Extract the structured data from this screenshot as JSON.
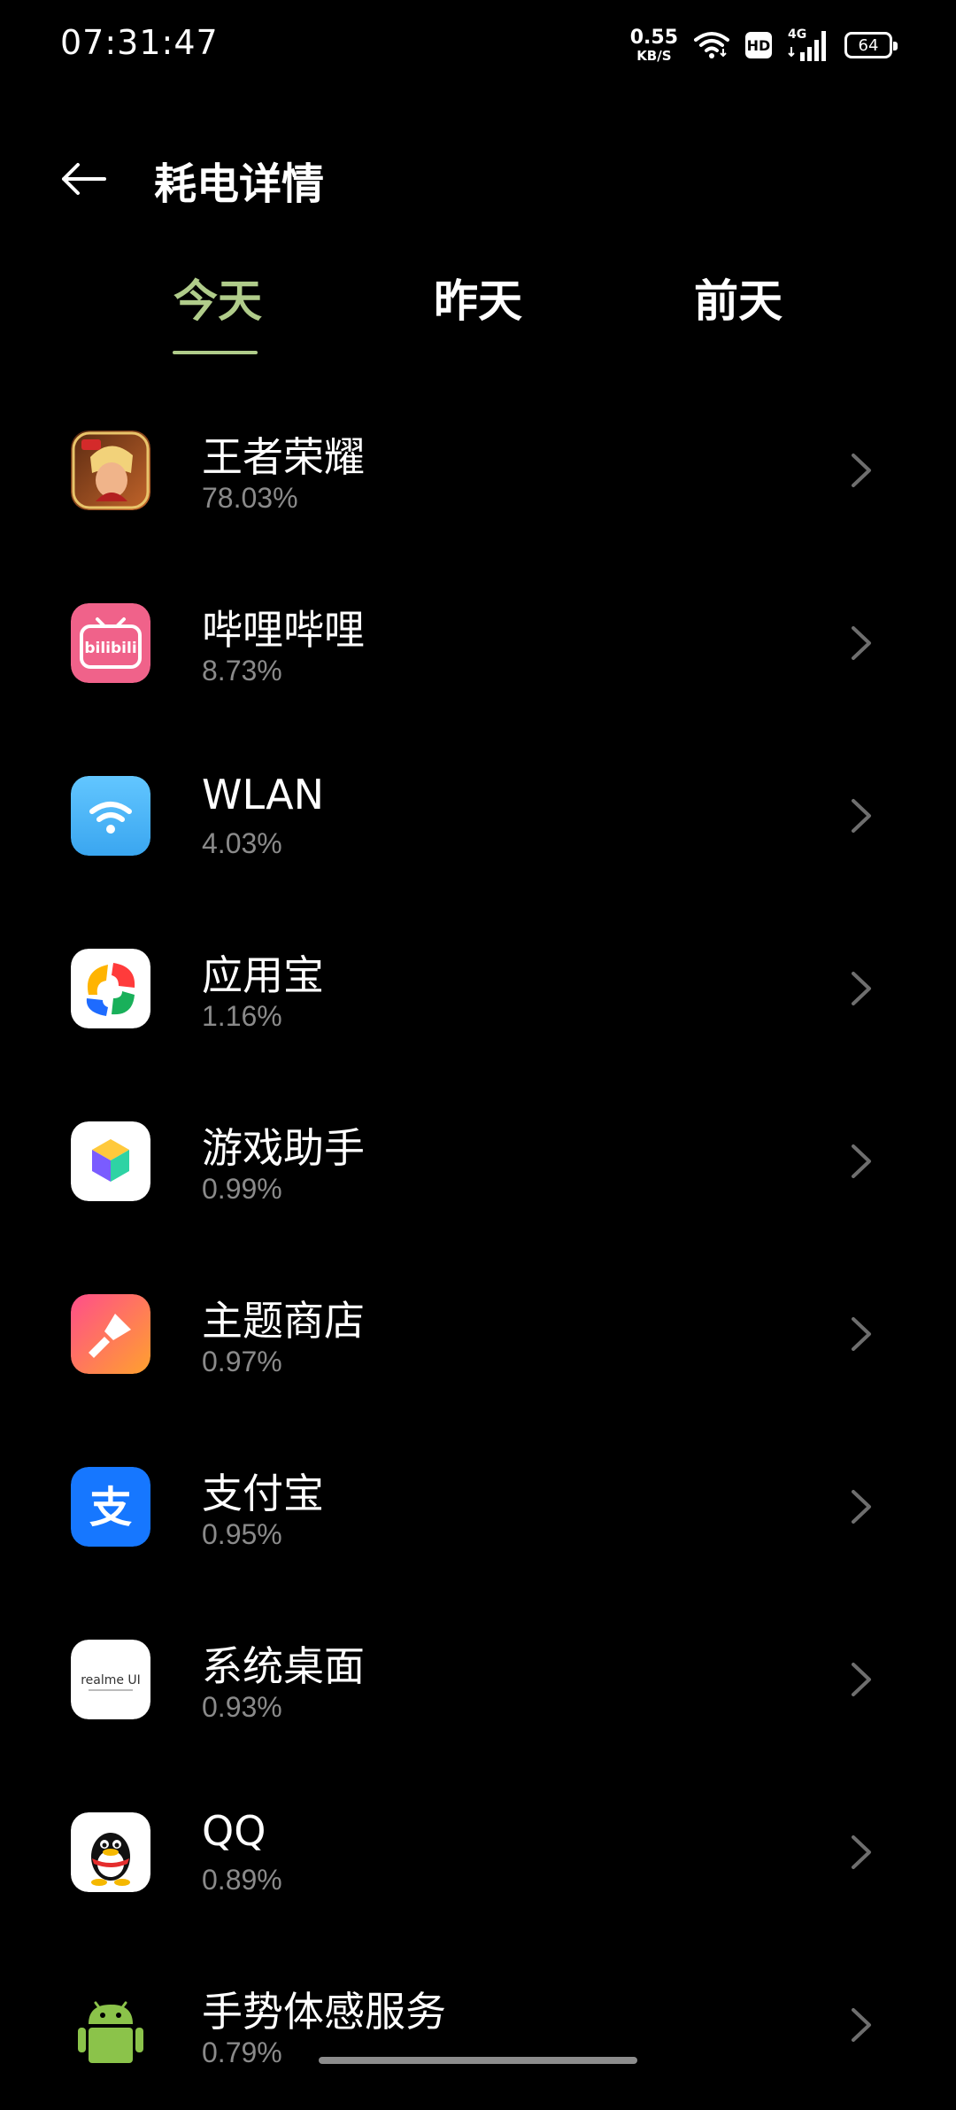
{
  "status_bar": {
    "time": "07:31:47",
    "net_speed_value": "0.55",
    "net_speed_unit": "KB/S",
    "hd_label": "HD",
    "network_type": "4G",
    "battery_level": "64",
    "icons": [
      "wifi-icon",
      "hd-icon",
      "cell-signal-icon",
      "battery-icon"
    ]
  },
  "header": {
    "title": "耗电详情",
    "back_icon": "arrow-left-icon"
  },
  "tabs": [
    {
      "label": "今天",
      "active": true
    },
    {
      "label": "昨天",
      "active": false
    },
    {
      "label": "前天",
      "active": false
    }
  ],
  "accent_color": "#b0cc8a",
  "apps": [
    {
      "name": "王者荣耀",
      "percent": "78.03%",
      "icon": "honor-of-kings-icon"
    },
    {
      "name": "哔哩哔哩",
      "percent": "8.73%",
      "icon": "bilibili-icon",
      "icon_text": "bilibili"
    },
    {
      "name": "WLAN",
      "percent": "4.03%",
      "icon": "wlan-icon"
    },
    {
      "name": "应用宝",
      "percent": "1.16%",
      "icon": "app-store-icon"
    },
    {
      "name": "游戏助手",
      "percent": "0.99%",
      "icon": "game-assistant-icon"
    },
    {
      "name": "主题商店",
      "percent": "0.97%",
      "icon": "theme-store-icon"
    },
    {
      "name": "支付宝",
      "percent": "0.95%",
      "icon": "alipay-icon",
      "icon_text": "支"
    },
    {
      "name": "系统桌面",
      "percent": "0.93%",
      "icon": "system-launcher-icon",
      "icon_text": "realme UI"
    },
    {
      "name": "QQ",
      "percent": "0.89%",
      "icon": "qq-icon"
    },
    {
      "name": "手势体感服务",
      "percent": "0.79%",
      "icon": "android-icon"
    }
  ]
}
